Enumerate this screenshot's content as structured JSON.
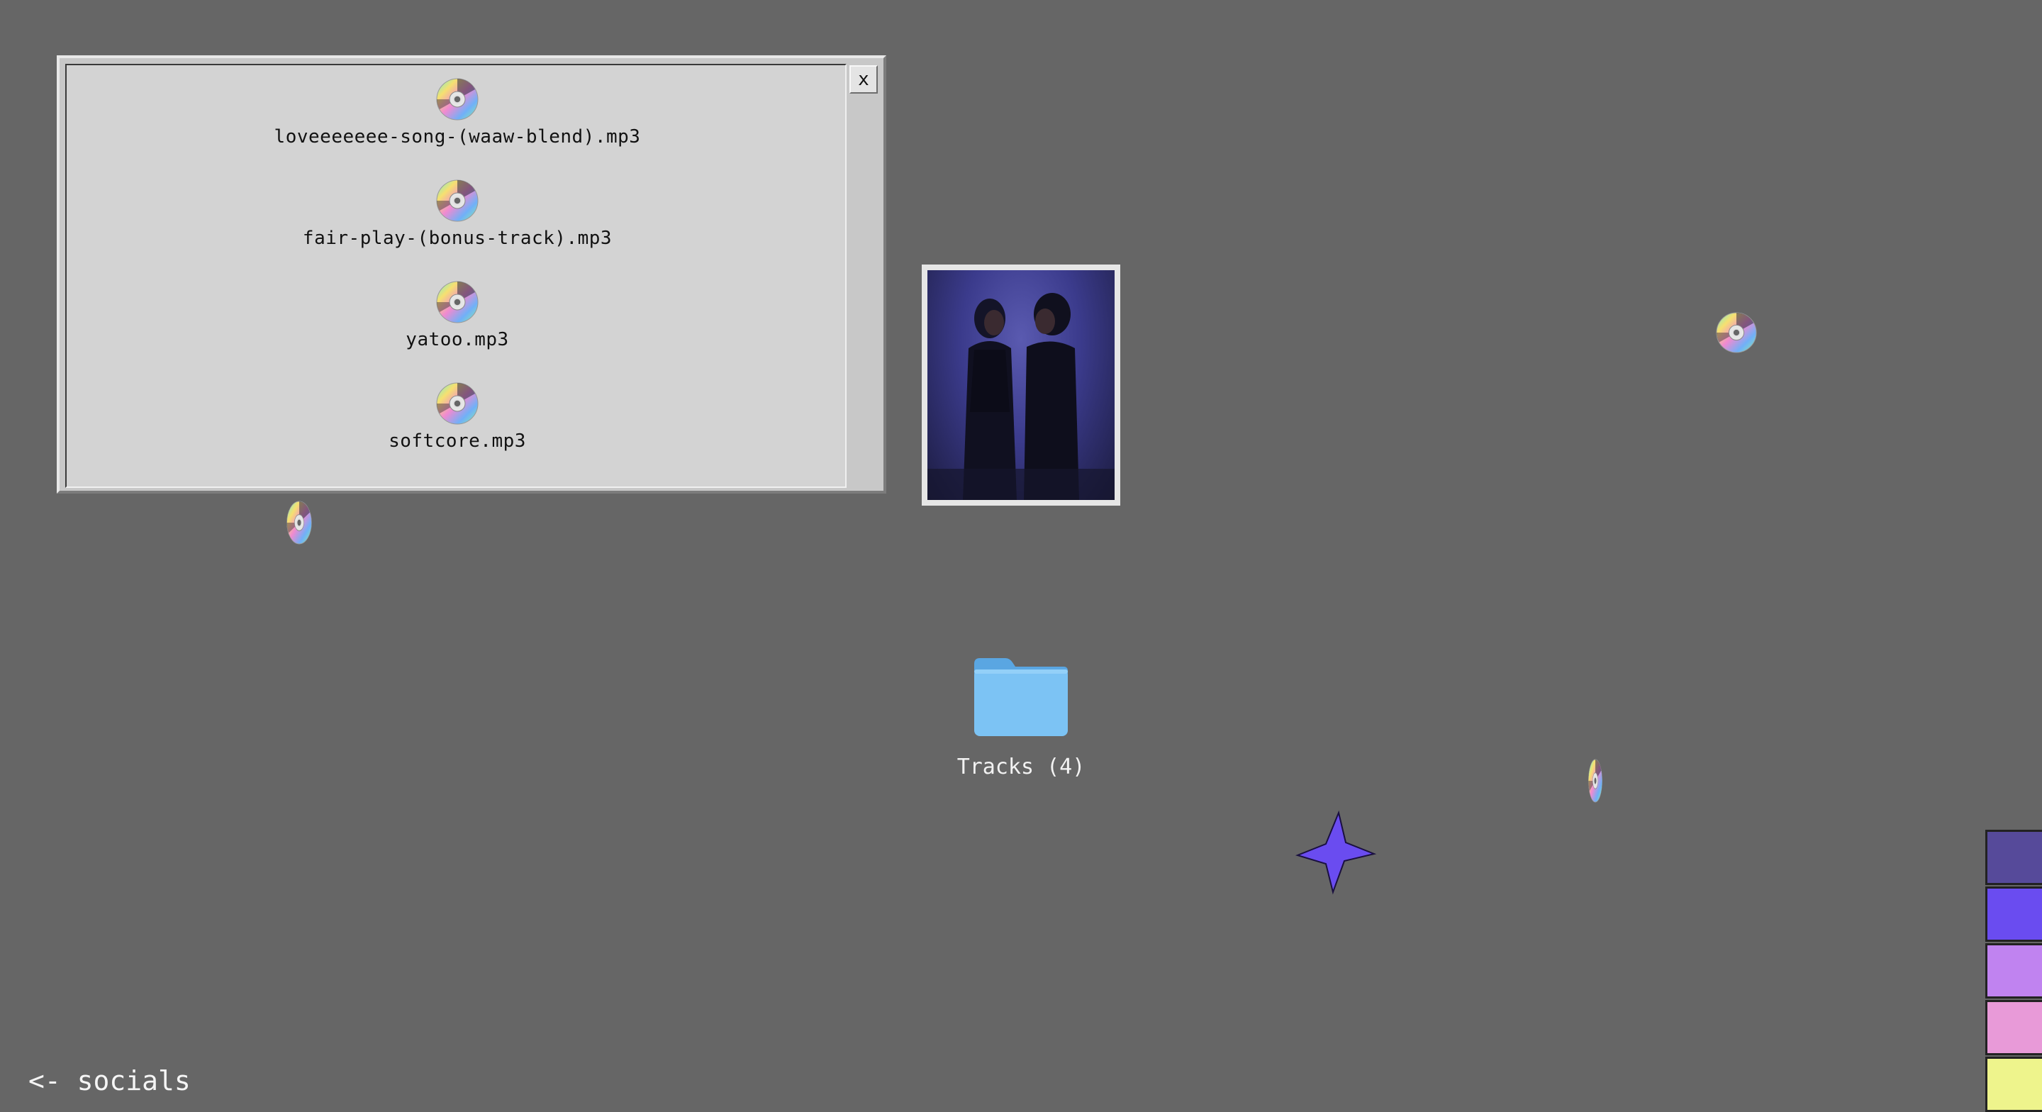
{
  "window": {
    "close_label": "x",
    "tracks": [
      {
        "filename": "loveeeeeee-song-(waaw-blend).mp3",
        "icon": "cd-icon"
      },
      {
        "filename": "fair-play-(bonus-track).mp3",
        "icon": "cd-icon"
      },
      {
        "filename": "yatoo.mp3",
        "icon": "cd-icon"
      },
      {
        "filename": "softcore.mp3",
        "icon": "cd-icon"
      }
    ]
  },
  "desktop": {
    "folder": {
      "label": "Tracks (4)",
      "icon": "folder-icon",
      "color": "#7cc3f4"
    },
    "photo": {
      "icon": "photo"
    },
    "star": {
      "color": "#6a4cf0",
      "icon": "star-icon"
    },
    "socials_link": "<- socials"
  },
  "palette": {
    "swatches": [
      "#564a9a",
      "#6a4cf0",
      "#c083f0",
      "#e89ad8",
      "#eef48c"
    ]
  }
}
